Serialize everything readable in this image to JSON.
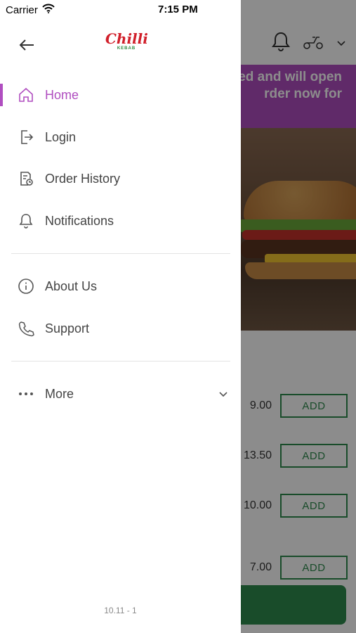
{
  "status_bar": {
    "carrier": "Carrier",
    "time": "7:15 PM"
  },
  "brand": {
    "logo_text": "Chilli",
    "logo_subtext": "KEBAB"
  },
  "menu": {
    "primary": [
      {
        "label": "Home",
        "icon": "home-icon",
        "active": true
      },
      {
        "label": "Login",
        "icon": "login-icon"
      },
      {
        "label": "Order History",
        "icon": "order-history-icon"
      },
      {
        "label": "Notifications",
        "icon": "bell-icon"
      }
    ],
    "secondary": [
      {
        "label": "About Us",
        "icon": "info-icon"
      },
      {
        "label": "Support",
        "icon": "phone-icon"
      }
    ],
    "more_label": "More"
  },
  "version": "10.11 - 1",
  "background": {
    "banner_line1": "ed and will open",
    "banner_line2": "rder now for",
    "items": [
      {
        "price": "9.00",
        "button": "ADD"
      },
      {
        "price": "13.50",
        "button": "ADD"
      },
      {
        "price": "10.00",
        "button": "ADD"
      },
      {
        "price": "7.00",
        "button": "ADD"
      }
    ]
  },
  "colors": {
    "accent": "#b04ec0",
    "brand_red": "#d11f2a",
    "add_green": "#2f8a4d"
  }
}
